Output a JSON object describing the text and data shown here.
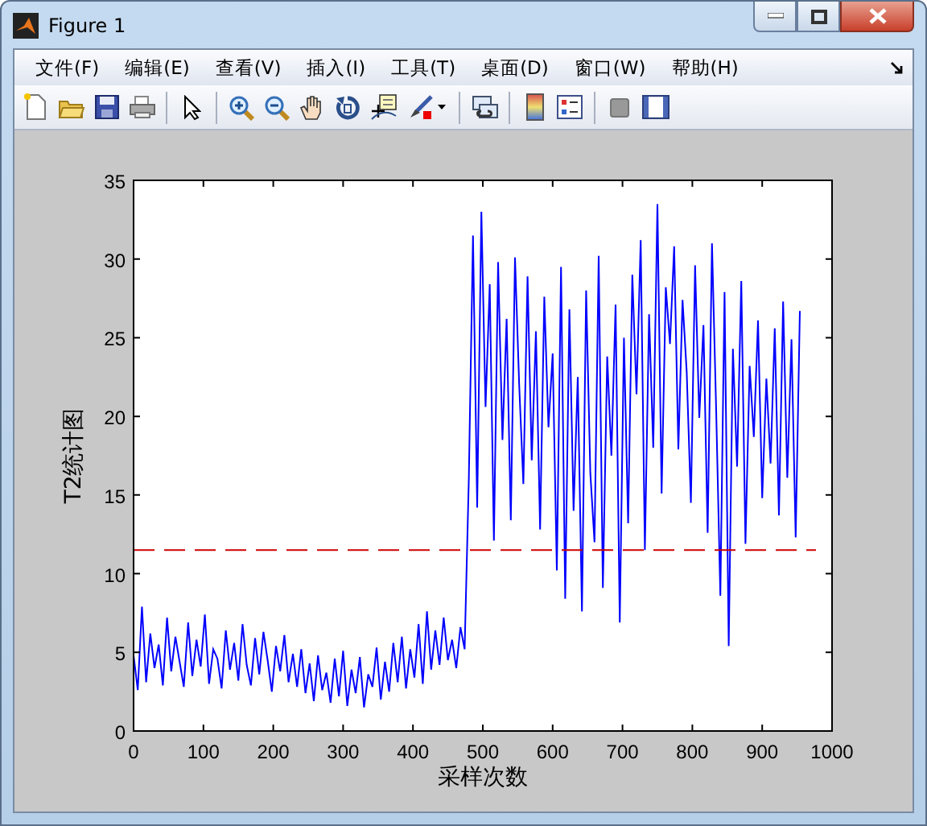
{
  "window": {
    "title": "Figure 1"
  },
  "menu": [
    "文件(F)",
    "编辑(E)",
    "查看(V)",
    "插入(I)",
    "工具(T)",
    "桌面(D)",
    "窗口(W)",
    "帮助(H)"
  ],
  "chart_data": {
    "type": "line",
    "xlabel": "采样次数",
    "ylabel": "T2统计图",
    "xlim": [
      0,
      1000
    ],
    "ylim": [
      0,
      35
    ],
    "xticks": [
      0,
      100,
      200,
      300,
      400,
      500,
      600,
      700,
      800,
      900,
      1000
    ],
    "yticks": [
      0,
      5,
      10,
      15,
      20,
      25,
      30,
      35
    ],
    "x": [
      0,
      6,
      12,
      18,
      24,
      30,
      36,
      42,
      48,
      54,
      60,
      66,
      72,
      78,
      84,
      90,
      96,
      102,
      108,
      114,
      120,
      126,
      132,
      138,
      144,
      150,
      156,
      162,
      168,
      174,
      180,
      186,
      192,
      198,
      204,
      210,
      216,
      222,
      228,
      234,
      240,
      246,
      252,
      258,
      264,
      270,
      276,
      282,
      288,
      294,
      300,
      306,
      312,
      318,
      324,
      330,
      336,
      342,
      348,
      354,
      360,
      366,
      372,
      378,
      384,
      390,
      396,
      402,
      408,
      414,
      420,
      426,
      432,
      438,
      444,
      450,
      456,
      462,
      468,
      474,
      480,
      486,
      492,
      498,
      504,
      510,
      516,
      522,
      528,
      534,
      540,
      546,
      552,
      558,
      564,
      570,
      576,
      582,
      588,
      594,
      600,
      606,
      612,
      618,
      624,
      630,
      636,
      642,
      648,
      654,
      660,
      666,
      672,
      678,
      684,
      690,
      696,
      702,
      708,
      714,
      720,
      726,
      732,
      738,
      744,
      750,
      756,
      762,
      768,
      774,
      780,
      786,
      792,
      798,
      804,
      810,
      816,
      822,
      828,
      834,
      840,
      846,
      852,
      858,
      864,
      870,
      876,
      882,
      888,
      894,
      900,
      906,
      912,
      918,
      924,
      930,
      936,
      942,
      948,
      954
    ],
    "series": [
      {
        "color": "#0000ff",
        "values": [
          4.8,
          2.6,
          7.9,
          3.1,
          6.2,
          4.0,
          5.5,
          2.9,
          7.2,
          3.8,
          6.0,
          4.4,
          2.8,
          6.9,
          3.5,
          5.8,
          4.1,
          7.4,
          3.0,
          5.2,
          4.6,
          2.7,
          6.4,
          3.9,
          5.6,
          3.2,
          6.8,
          4.2,
          2.9,
          5.9,
          3.6,
          6.3,
          4.5,
          2.5,
          5.4,
          3.8,
          6.1,
          3.1,
          4.9,
          2.8,
          5.2,
          2.4,
          4.3,
          1.9,
          4.8,
          2.6,
          3.7,
          1.8,
          4.6,
          2.2,
          5.1,
          1.6,
          3.9,
          2.4,
          4.7,
          1.5,
          3.6,
          2.8,
          5.3,
          2.0,
          4.4,
          2.5,
          5.6,
          3.1,
          6.0,
          2.7,
          5.2,
          3.4,
          6.8,
          3.0,
          7.6,
          3.9,
          6.4,
          4.2,
          7.2,
          4.5,
          5.8,
          4.0,
          6.6,
          5.2,
          16.0,
          31.5,
          14.2,
          33.0,
          20.6,
          28.4,
          12.1,
          29.8,
          18.5,
          26.2,
          13.4,
          30.1,
          22.0,
          15.7,
          28.9,
          17.2,
          25.4,
          12.8,
          27.6,
          19.3,
          24.0,
          10.2,
          29.5,
          8.4,
          26.8,
          14.0,
          22.5,
          7.6,
          28.0,
          16.4,
          12.0,
          30.2,
          9.1,
          23.8,
          17.5,
          27.1,
          6.9,
          25.0,
          13.2,
          29.0,
          21.4,
          31.2,
          11.5,
          26.5,
          18.0,
          33.5,
          15.1,
          28.2,
          24.6,
          30.8,
          17.9,
          27.4,
          22.8,
          14.5,
          29.6,
          19.9,
          25.8,
          12.6,
          31.0,
          20.4,
          8.6,
          27.9,
          5.4,
          24.3,
          16.8,
          28.6,
          11.9,
          23.2,
          18.7,
          26.1,
          14.8,
          22.4,
          17.0,
          25.6,
          13.7,
          27.3,
          16.1,
          24.9,
          12.3,
          26.7
        ]
      }
    ],
    "ref_lines": [
      {
        "axis": "y",
        "value": 11.5,
        "color": "#cc0000"
      }
    ]
  }
}
